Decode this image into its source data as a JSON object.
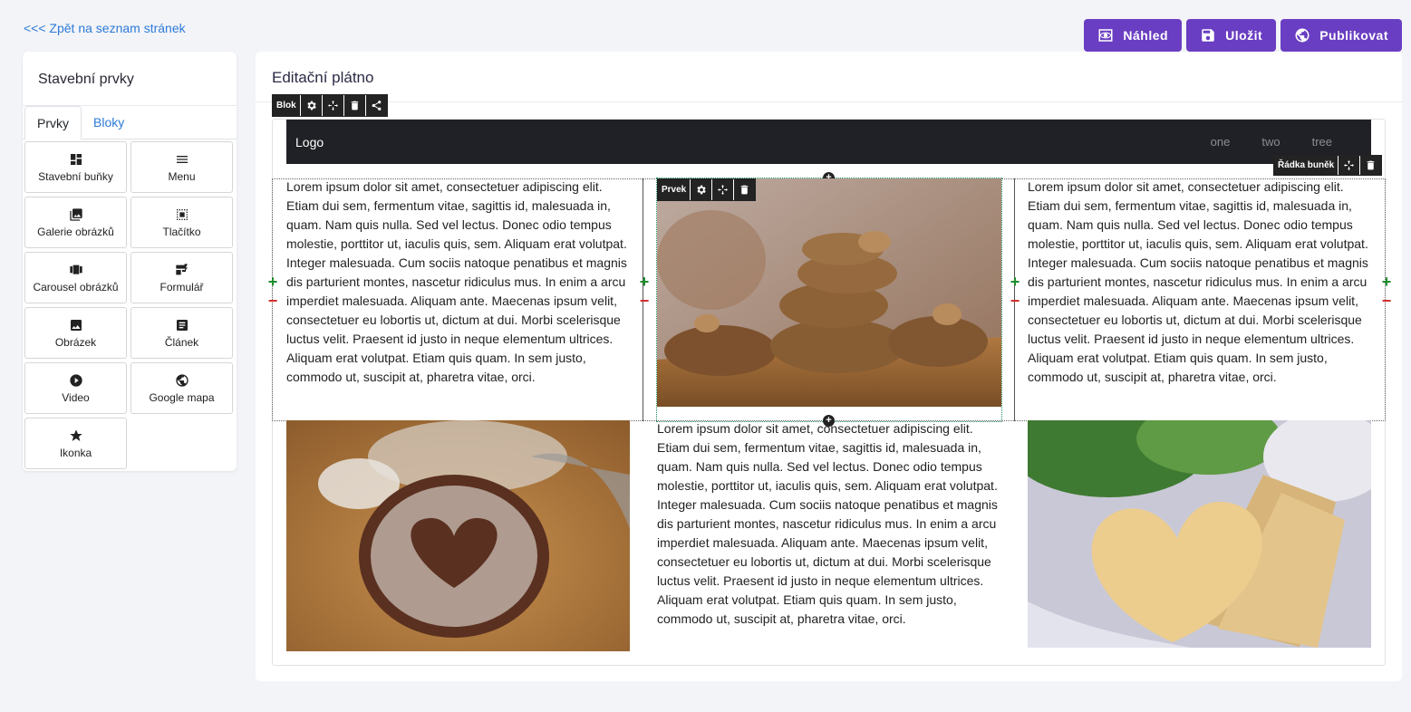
{
  "nav": {
    "back_label": "<<< Zpět na seznam stránek"
  },
  "actions": {
    "preview": "Náhled",
    "save": "Uložit",
    "publish": "Publikovat"
  },
  "sidebar": {
    "title": "Stavební prvky",
    "tabs": [
      "Prvky",
      "Bloky"
    ],
    "items": [
      {
        "label": "Stavební buňky",
        "icon": "grid-layout-icon"
      },
      {
        "label": "Menu",
        "icon": "menu-icon"
      },
      {
        "label": "Galerie obrázků",
        "icon": "gallery-icon"
      },
      {
        "label": "Tlačítko",
        "icon": "button-icon"
      },
      {
        "label": "Carousel obrázků",
        "icon": "carousel-icon"
      },
      {
        "label": "Formulář",
        "icon": "form-icon"
      },
      {
        "label": "Obrázek",
        "icon": "image-icon"
      },
      {
        "label": "Článek",
        "icon": "article-icon"
      },
      {
        "label": "Video",
        "icon": "play-icon"
      },
      {
        "label": "Google mapa",
        "icon": "globe-icon"
      },
      {
        "label": "Ikonka",
        "icon": "star-icon"
      }
    ]
  },
  "canvas": {
    "title": "Editační plátno",
    "block_toolbar": {
      "label": "Blok"
    },
    "element_toolbar": {
      "label": "Prvek"
    },
    "row_toolbar": {
      "label": "Řádka buněk"
    },
    "navbar": {
      "brand": "Logo",
      "links": [
        "one",
        "two",
        "tree"
      ]
    },
    "lorem": "Lorem ipsum dolor sit amet, consectetuer adipiscing elit. Etiam dui sem, fermentum vitae, sagittis id, malesuada in, quam. Nam quis nulla. Sed vel lectus. Donec odio tempus molestie, porttitor ut, iaculis quis, sem. Aliquam erat volutpat. Integer malesuada. Cum sociis natoque penatibus et magnis dis parturient montes, nascetur ridiculus mus. In enim a arcu imperdiet malesuada. Aliquam ante. Maecenas ipsum velit, consectetuer eu lobortis ut, dictum at dui. Morbi scelerisque luctus velit. Praesent id justo in neque elementum ultrices. Aliquam erat volutpat. Etiam quis quam. In sem justo, commodo ut, suscipit at, pharetra vitae, orci."
  },
  "colors": {
    "accent": "#6a3ec2",
    "link": "#2d7bd8",
    "navbar": "#202126"
  }
}
